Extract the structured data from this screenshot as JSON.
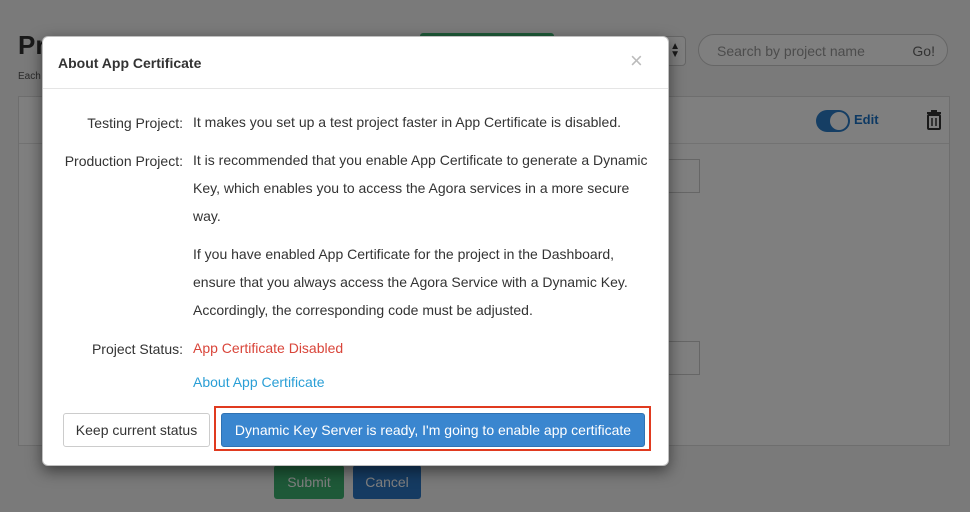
{
  "background": {
    "page_title": "Pr",
    "page_subtitle": "Each",
    "search": {
      "placeholder": "Search by project name",
      "go_label": "Go!"
    },
    "edit_label": "Edit",
    "submit_label": "Submit",
    "cancel_label": "Cancel"
  },
  "modal": {
    "title": "About App Certificate",
    "close_symbol": "×",
    "rows": {
      "testing": {
        "label": "Testing Project:",
        "text": "It makes you set up a test project faster in App Certificate is disabled."
      },
      "production": {
        "label": "Production Project:",
        "text1": "It is recommended that you enable App Certificate to generate a Dynamic Key, which enables you to access the Agora services in a more secure way.",
        "text2": "If you have enabled App Certificate for the project in the Dashboard, ensure that you always access the Agora Service with a Dynamic Key. Accordingly, the corresponding code must be adjusted."
      },
      "status": {
        "label": "Project Status:",
        "value": "App Certificate Disabled",
        "link": "About App Certificate"
      }
    },
    "buttons": {
      "keep": "Keep current status",
      "enable": "Dynamic Key Server is ready, I'm going to enable app certificate"
    }
  },
  "colors": {
    "status_red": "#d9453a",
    "link_blue": "#2a9fd6",
    "primary_blue": "#3a86cf",
    "highlight_red": "#e03a1f"
  }
}
